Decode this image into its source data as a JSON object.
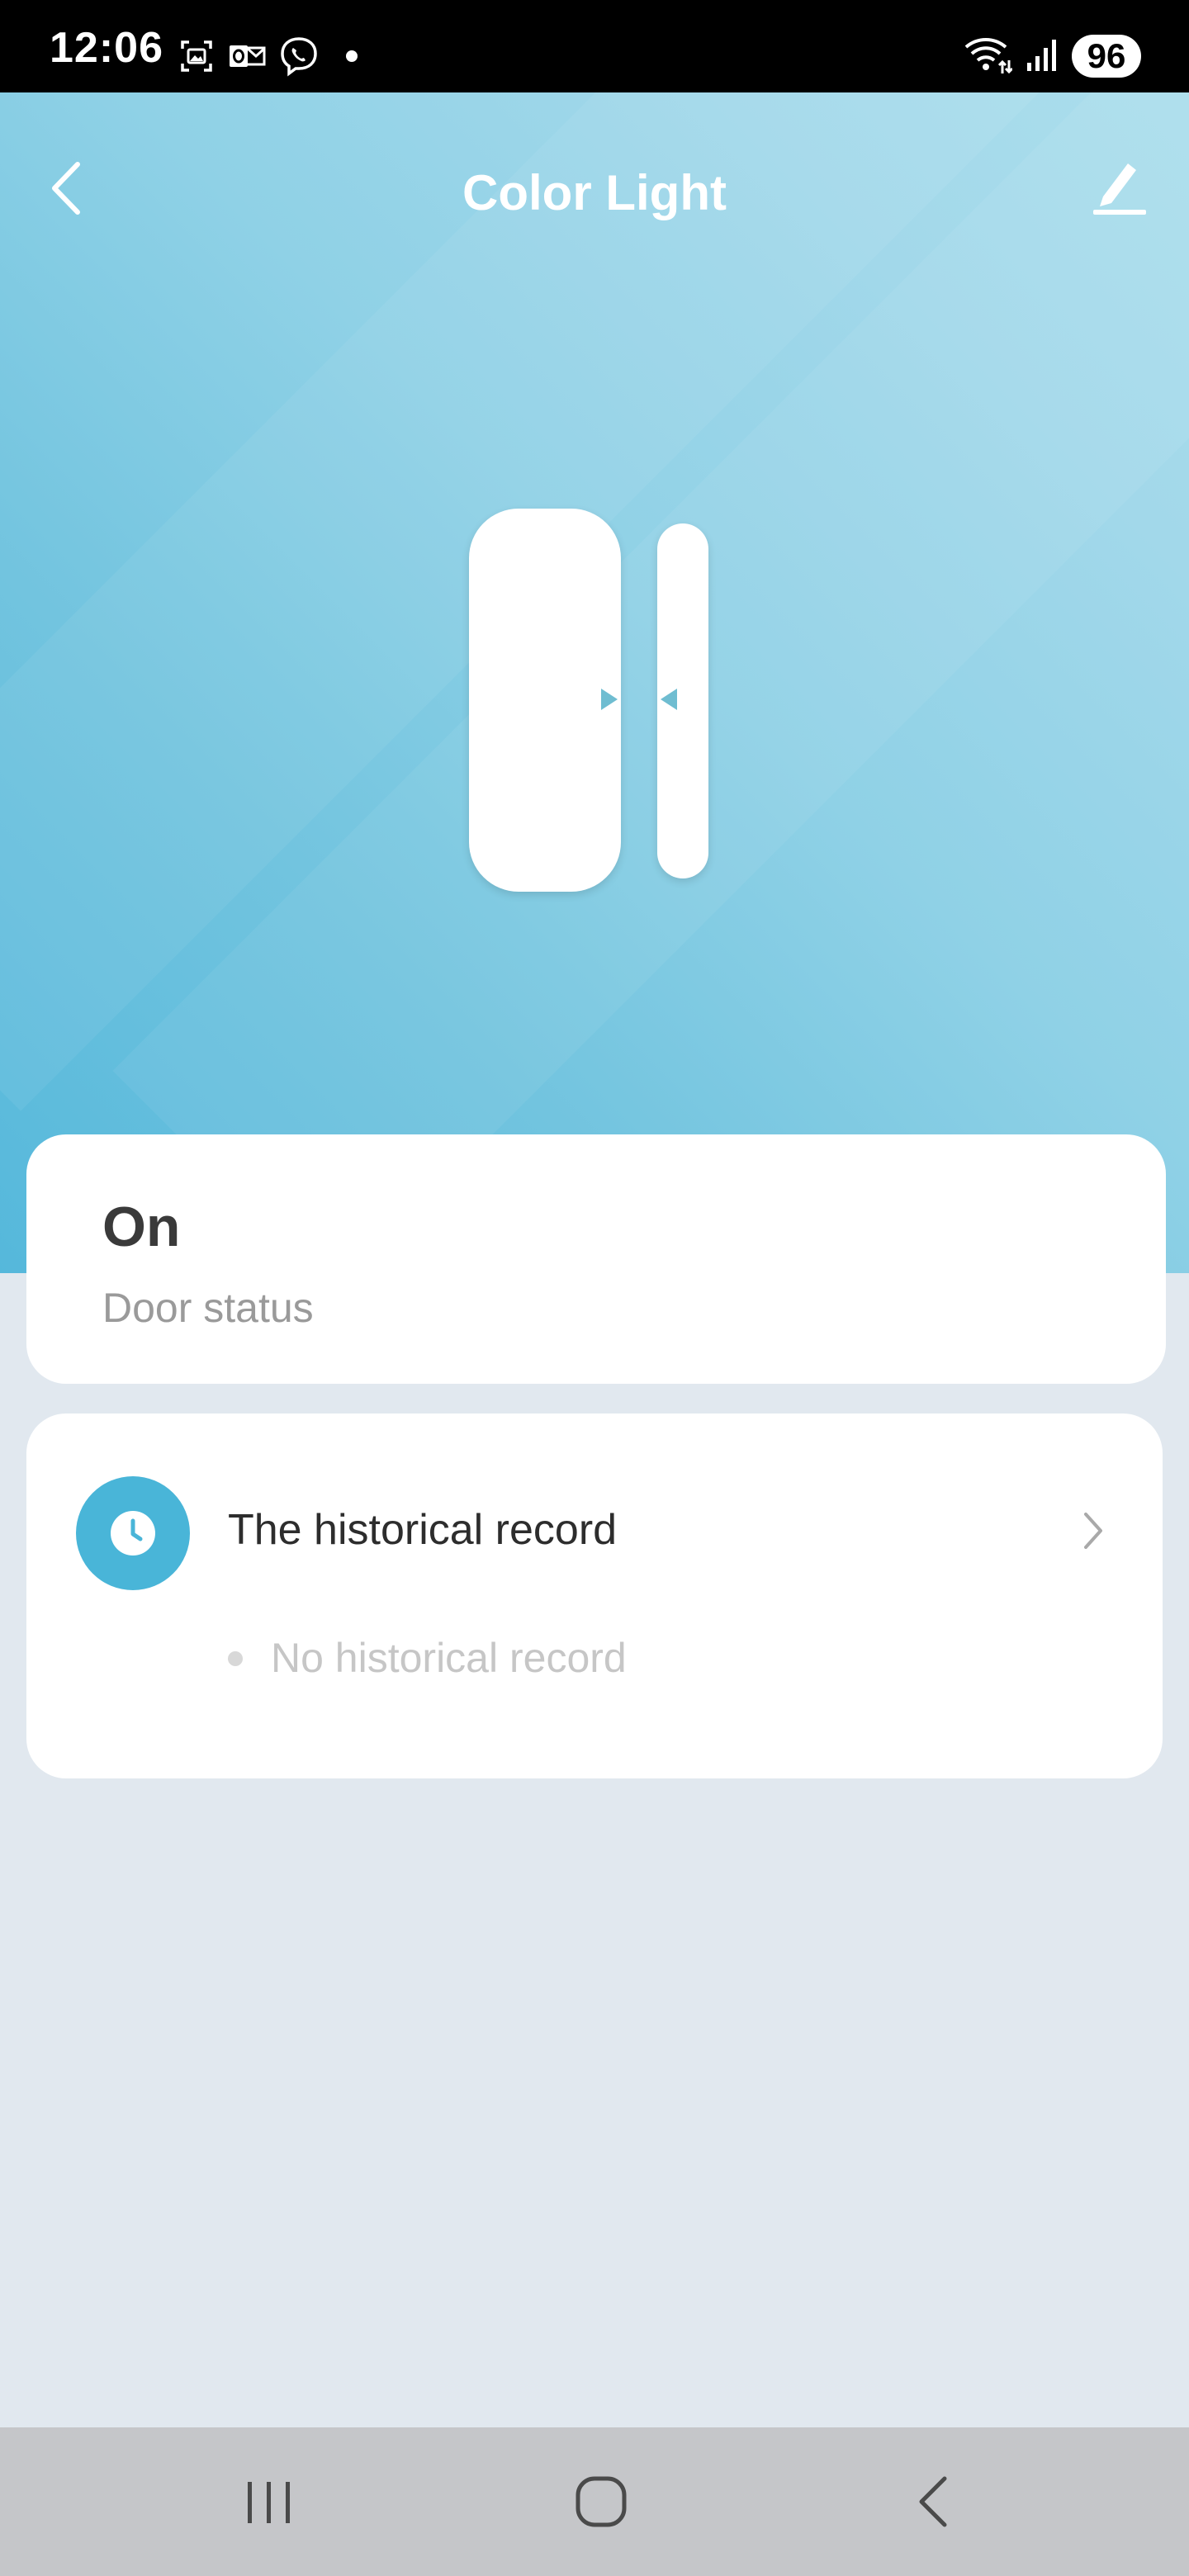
{
  "status_bar": {
    "time": "12:06",
    "battery": "96",
    "icons_left": [
      "gallery-notification-icon",
      "outlook-notification-icon",
      "viber-notification-icon",
      "more-notifications-dot"
    ],
    "icons_right": [
      "wifi-icon",
      "signal-icon",
      "battery-icon"
    ]
  },
  "header": {
    "title": "Color Light",
    "back_icon": "chevron-left-icon",
    "edit_icon": "pencil-icon"
  },
  "device": {
    "illustration": "door-sensor-illustration"
  },
  "status_card": {
    "value": "On",
    "label": "Door status"
  },
  "history_card": {
    "title": "The historical record",
    "empty_message": "No historical record",
    "icon": "clock-icon"
  },
  "nav_bar": {
    "buttons": [
      "recent-apps",
      "home",
      "back"
    ]
  },
  "colors": {
    "hero_gradient_light": "#abdeec",
    "hero_gradient_dark": "#55b8db",
    "accent": "#49b5d8",
    "background": "#e1e8ef",
    "card": "#ffffff",
    "nav_bar": "#c5c6c9"
  }
}
